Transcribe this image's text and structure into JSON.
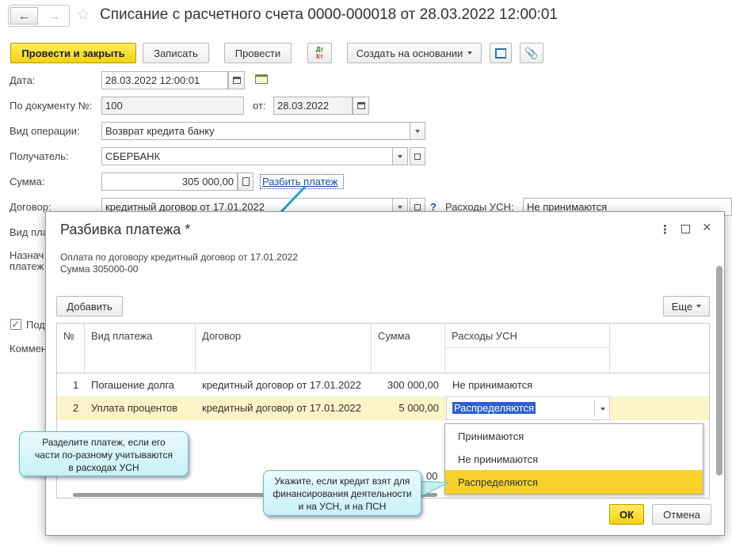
{
  "window": {
    "title": "Списание с расчетного счета 0000-000018 от 28.03.2022 12:00:01"
  },
  "toolbar": {
    "post_close": "Провести и закрыть",
    "save": "Записать",
    "post": "Провести",
    "dtkt_dt": "Дт",
    "dtkt_kt": "Кт",
    "create_basis": "Создать на основании"
  },
  "form": {
    "date_label": "Дата:",
    "date_value": "28.03.2022 12:00:01",
    "doc_label": "По документу №:",
    "doc_value": "100",
    "from_label": "от:",
    "from_value": "28.03.2022",
    "op_label": "Вид операции:",
    "op_value": "Возврат кредита банку",
    "recipient_label": "Получатель:",
    "recipient_value": "СБЕРБАНК",
    "sum_label": "Сумма:",
    "sum_value": "305 000,00",
    "split_link": "Разбить платеж",
    "contract_label": "Договор:",
    "contract_value": "кредитный договор от 17.01.2022",
    "help_mark": "?",
    "usn_label": "Расходы УСН:",
    "usn_value": "Не принимаются",
    "vid_label_partial": "Вид пла",
    "naz_label_partial1": "Назнач",
    "naz_label_partial2": "платеж",
    "check_label_partial": "Под",
    "comment_label_partial": "Коммен"
  },
  "modal": {
    "title": "Разбивка платежа *",
    "info_line1": "Оплата по договору кредитный договор от 17.01.2022",
    "info_line2": "Сумма 305000-00",
    "add_button": "Добавить",
    "more_button": "Еще",
    "ok_button": "ОК",
    "cancel_button": "Отмена",
    "columns": [
      "№",
      "Вид платежа",
      "Договор",
      "Сумма",
      "Расходы УСН"
    ],
    "rows": [
      {
        "n": "1",
        "type": "Погашение долга",
        "contract": "кредитный договор от 17.01.2022",
        "sum": "300 000,00",
        "usn": "Не принимаются"
      },
      {
        "n": "2",
        "type": "Уплата процентов",
        "contract": "кредитный договор от 17.01.2022",
        "sum": "5 000,00",
        "usn": "Распределяются"
      }
    ],
    "footer_partial": "00",
    "dropdown": [
      "Принимаются",
      "Не принимаются",
      "Распределяются"
    ],
    "dropdown_selected": "Распределяются"
  },
  "callouts": {
    "left_line1": "Разделите платеж, если его",
    "left_line2": "части по-разному учитываются",
    "left_line3": "в расходах УСН",
    "right_line1": "Укажите, если кредит взят для",
    "right_line2": "финансирования деятельности",
    "right_line3": "и на УСН, и на ПСН"
  },
  "colors": {
    "accent_yellow": "#f4d213",
    "selection_yellow": "#f8d22a",
    "row_highlight": "#fdf3c9",
    "link_blue": "#1a4ea8",
    "callout_border": "#5fbfd1"
  }
}
